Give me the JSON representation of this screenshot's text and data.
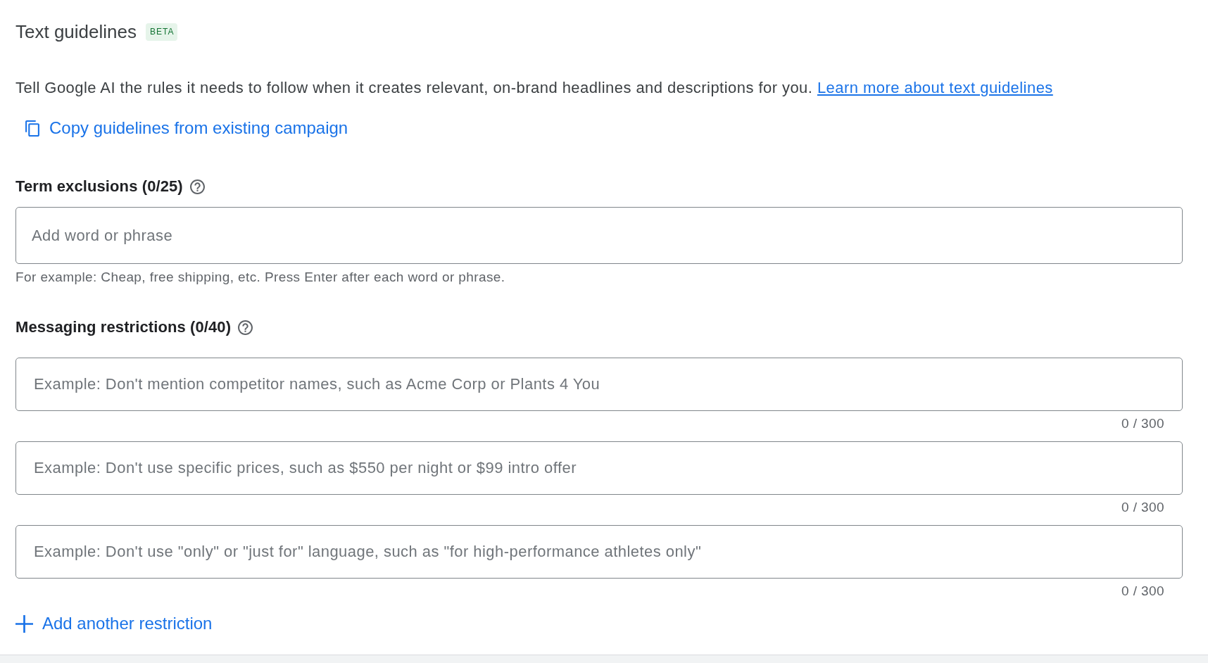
{
  "header": {
    "title": "Text guidelines",
    "badge": "BETA"
  },
  "description": {
    "text": "Tell Google AI the rules it needs to follow when it creates relevant, on-brand headlines and descriptions for you.",
    "link": "Learn more about text guidelines"
  },
  "copy_link": {
    "label": "Copy guidelines from existing campaign"
  },
  "term_exclusions": {
    "label": "Term exclusions (0/25)",
    "input": {
      "placeholder": "Add word or phrase"
    },
    "hint": "For example: Cheap, free shipping, etc. Press Enter after each word or phrase."
  },
  "messaging_restrictions": {
    "label": "Messaging restrictions (0/40)",
    "restrictions": [
      {
        "placeholder": "Example: Don't mention competitor names, such as Acme Corp or Plants 4 You",
        "counter": "0 / 300"
      },
      {
        "placeholder": "Example: Don't use specific prices, such as $550 per night or $99 intro offer",
        "counter": "0 / 300"
      },
      {
        "placeholder": "Example: Don't use \"only\" or \"just for\" language, such as \"for high-performance athletes only\"",
        "counter": "0 / 300"
      }
    ]
  },
  "add_button": {
    "label": "Add another restriction"
  }
}
